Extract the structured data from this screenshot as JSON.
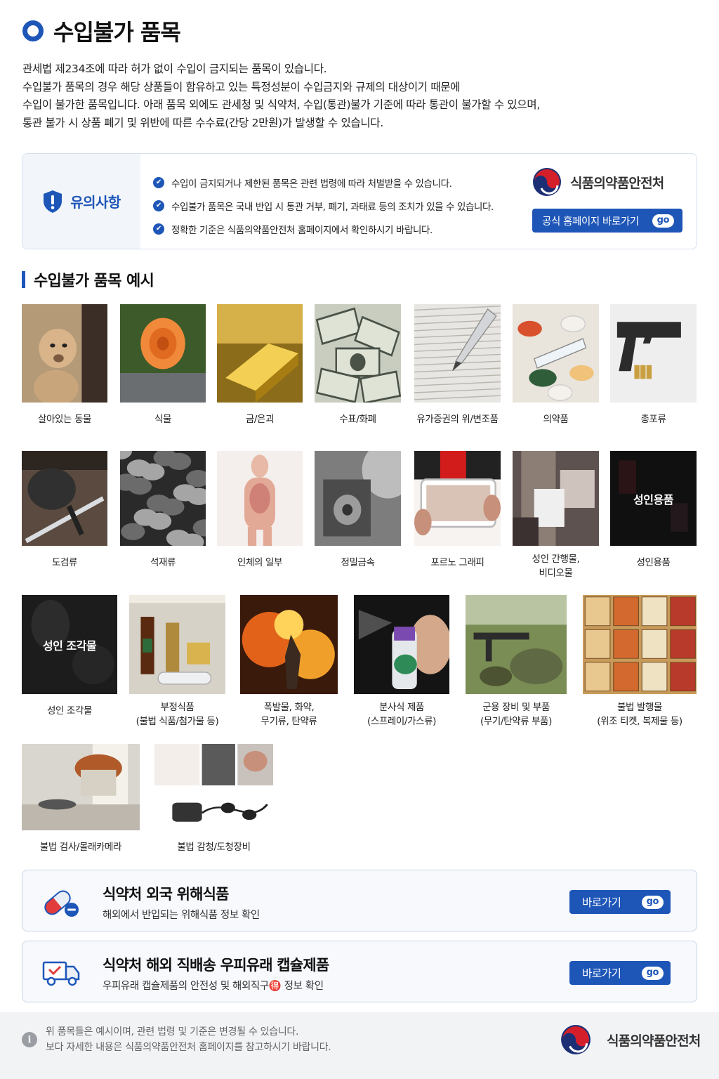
{
  "header": {
    "title": "수입불가 품목",
    "intro": [
      "관세법 제234조에 따라 허가 없이 수입이 금지되는 품목이 있습니다.",
      "수입불가 품목의 경우 해당 상품들이 함유하고 있는 특정성분이 수입금지와 규제의 대상이기 때문에",
      "수입이 불가한 품목입니다. 아래 품목 외에도 관세청 및 식약처, 수입(통관)불가 기준에 따라 통관이 불가할 수 있으며,",
      "통관 불가 시 상품 폐기 및 위반에 따른 수수료(간당 2만원)가 발생할 수 있습니다."
    ]
  },
  "notice": {
    "label": "유의사항",
    "items": [
      "수입이 금지되거나 제한된 품목은 관련 법령에 따라 처벌받을 수 있습니다.",
      "수입불가 품목은 국내 반입 시 통관 거부, 폐기, 과태료 등의 조치가 있을 수 있습니다.",
      "정확한 기준은 식품의약품안전처 홈페이지에서 확인하시기 바랍니다."
    ],
    "agency_name": "식품의약품안전처",
    "homepage_button": "공식 홈페이지 바로가기",
    "go": "go"
  },
  "section": {
    "title": "수입불가 품목 예시"
  },
  "items": [
    {
      "id": "live-animals",
      "caption": [
        "살아있는 동물"
      ],
      "icon": "lion-cub-photo"
    },
    {
      "id": "plants",
      "caption": [
        "식물"
      ],
      "icon": "orange-rose-photo"
    },
    {
      "id": "gold-silver",
      "caption": [
        "금/은괴"
      ],
      "icon": "gold-bar-photo"
    },
    {
      "id": "currency",
      "caption": [
        "수표/화폐"
      ],
      "icon": "dollar-bills-photo"
    },
    {
      "id": "securities",
      "caption": [
        "유가증권의 위/변조품"
      ],
      "icon": "pen-on-document-photo"
    },
    {
      "id": "medicine",
      "caption": [
        "의약품"
      ],
      "icon": "pills-syringe-photo"
    },
    {
      "id": "firearms",
      "caption": [
        "총포류"
      ],
      "icon": "pistol-bullets-photo"
    },
    {
      "id": "swords",
      "caption": [
        "도검류"
      ],
      "icon": "sword-photo"
    },
    {
      "id": "stones",
      "caption": [
        "석재류"
      ],
      "icon": "coal-stones-photo"
    },
    {
      "id": "human-parts",
      "caption": [
        "인체의 일부"
      ],
      "icon": "anatomy-blurred-photo"
    },
    {
      "id": "precision-metal",
      "caption": [
        "정밀금속"
      ],
      "icon": "saw-blade-photo"
    },
    {
      "id": "pornography",
      "caption": [
        "포르노 그래피"
      ],
      "icon": "phone-blurred-photo"
    },
    {
      "id": "adult-publications",
      "caption": [
        "성인 간행물,",
        "비디오물"
      ],
      "icon": "blurred-person-photo"
    },
    {
      "id": "adult-goods",
      "caption": [
        "성인용품"
      ],
      "icon": "adult-goods-dark-photo",
      "overlay": "성인용품"
    },
    {
      "id": "adult-sculpture",
      "caption": [
        "성인 조각물"
      ],
      "icon": "adult-sculpture-dark-photo",
      "overlay": "성인 조각물"
    },
    {
      "id": "illegal-food",
      "caption": [
        "부정식품",
        "(불법 식품/첨가물 등)"
      ],
      "icon": "fridge-food-photo"
    },
    {
      "id": "explosives",
      "caption": [
        "폭발물, 화약,",
        "무기류, 탄약류"
      ],
      "icon": "explosion-soldier-photo"
    },
    {
      "id": "spray",
      "caption": [
        "분사식 제품",
        "(스프레이/가스류)"
      ],
      "icon": "spray-can-photo"
    },
    {
      "id": "military",
      "caption": [
        "군용 장비 및 부품",
        "(무기/탄약류 부품)"
      ],
      "icon": "military-gear-photo"
    },
    {
      "id": "illegal-print",
      "caption": [
        "불법 발행물",
        "(위조 티켓, 복제물 등)"
      ],
      "icon": "tickets-collage-photo"
    },
    {
      "id": "hidden-camera",
      "caption": [
        "불법 검사/몰래카메라"
      ],
      "icon": "hidden-camera-photo"
    },
    {
      "id": "wiretap",
      "caption": [
        "불법 감청/도청장비"
      ],
      "icon": "wiretap-collage-photo"
    }
  ],
  "links": [
    {
      "title": "식약처 외국 위해식품",
      "desc": "해외에서 반입되는 위해식품 정보 확인",
      "button": "바로가기",
      "go": "go",
      "icon": "pill-capsule-icon"
    },
    {
      "title": "식약처 해외 직배송 우피유래 캡슐제품",
      "desc": "우피유래 캡슐제품의 안전성 및 해외직구🉐 정보 확인",
      "button": "바로가기",
      "go": "go",
      "icon": "delivery-truck-icon"
    }
  ],
  "footer": {
    "lines": [
      "위 품목들은 예시이며, 관련 법령 및 기준은 변경될 수 있습니다.",
      "보다 자세한 내용은 식품의약품안전처 홈페이지를 참고하시기 바랍니다."
    ],
    "agency_name": "식품의약품안전처"
  },
  "colors": {
    "accent": "#1e56b8",
    "border": "#d6e0ef",
    "footer_bg": "#f2f3f5"
  }
}
